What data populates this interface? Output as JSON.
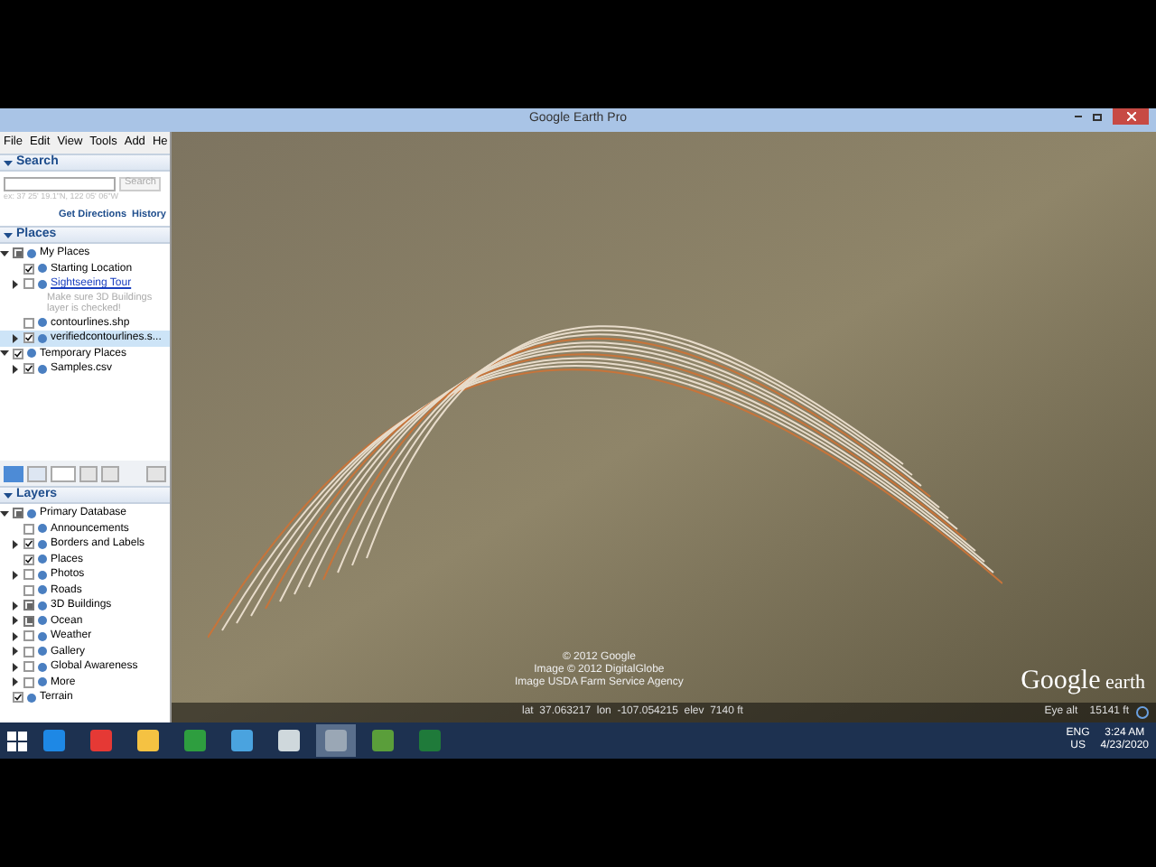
{
  "window": {
    "title": "Google Earth Pro"
  },
  "menu": [
    "File",
    "Edit",
    "View",
    "Tools",
    "Add",
    "He"
  ],
  "search": {
    "title": "Search",
    "placeholder": "ex: 37 25' 19.1\"N, 122 05' 06\"W",
    "button": "Search",
    "links": [
      "Get Directions",
      "History"
    ]
  },
  "places": {
    "title": "Places",
    "items": [
      {
        "label": "My Places",
        "checked": false,
        "partial": true,
        "expanded": true,
        "selected": false,
        "link": false,
        "children": [
          {
            "label": "Starting Location",
            "checked": true,
            "partial": false,
            "selected": false,
            "link": false
          },
          {
            "label": "Sightseeing Tour",
            "link": true,
            "note": "Make sure 3D Buildings layer is checked!",
            "checked": false,
            "partial": false,
            "expanded": false,
            "selected": false
          },
          {
            "label": "contourlines.shp",
            "checked": false,
            "partial": false,
            "selected": false,
            "link": false
          },
          {
            "label": "verifiedcontourlines.s...",
            "checked": true,
            "partial": false,
            "expanded": false,
            "selected": true,
            "link": false
          }
        ]
      },
      {
        "label": "Temporary Places",
        "checked": true,
        "partial": false,
        "expanded": true,
        "selected": false,
        "link": false,
        "children": [
          {
            "label": "Samples.csv",
            "checked": true,
            "partial": false,
            "expanded": false,
            "selected": false,
            "link": false
          }
        ]
      }
    ]
  },
  "layers": {
    "title": "Layers",
    "items": [
      {
        "label": "Primary Database",
        "checked": false,
        "partial": true,
        "expanded": true,
        "selected": false,
        "link": false,
        "children": [
          {
            "label": "Announcements",
            "checked": false,
            "partial": false,
            "selected": false,
            "link": false
          },
          {
            "label": "Borders and Labels",
            "checked": true,
            "partial": false,
            "expanded": false,
            "selected": false,
            "link": false
          },
          {
            "label": "Places",
            "checked": true,
            "partial": false,
            "selected": false,
            "link": false
          },
          {
            "label": "Photos",
            "checked": false,
            "partial": false,
            "expanded": false,
            "selected": false,
            "link": false
          },
          {
            "label": "Roads",
            "checked": false,
            "partial": false,
            "selected": false,
            "link": false
          },
          {
            "label": "3D Buildings",
            "checked": false,
            "partial": true,
            "expanded": false,
            "selected": false,
            "link": false
          },
          {
            "label": "Ocean",
            "checked": false,
            "partial": true,
            "expanded": false,
            "selected": false,
            "link": false
          },
          {
            "label": "Weather",
            "checked": false,
            "partial": false,
            "expanded": false,
            "selected": false,
            "link": false
          },
          {
            "label": "Gallery",
            "checked": false,
            "partial": false,
            "expanded": false,
            "selected": false,
            "link": false
          },
          {
            "label": "Global Awareness",
            "checked": false,
            "partial": false,
            "expanded": false,
            "selected": false,
            "link": false
          },
          {
            "label": "More",
            "checked": false,
            "partial": false,
            "expanded": false,
            "selected": false,
            "link": false
          }
        ]
      },
      {
        "label": "Terrain",
        "checked": true,
        "partial": false,
        "selected": false,
        "link": false
      }
    ]
  },
  "map": {
    "attribution": [
      "© 2012 Google",
      "Image © 2012 DigitalGlobe",
      "Image USDA Farm Service Agency"
    ],
    "logo_word": "Google",
    "logo_suffix": "earth",
    "coordinates": "lat  37.063217  lon  -107.054215  elev  7140 ft",
    "eye_alt": "Eye alt    15141 ft"
  },
  "taskbar": {
    "apps": [
      {
        "kind": "ie",
        "active": false
      },
      {
        "kind": "chrome",
        "active": false
      },
      {
        "kind": "folder",
        "active": false
      },
      {
        "kind": "store",
        "active": false
      },
      {
        "kind": "magnifier",
        "active": false
      },
      {
        "kind": "mic",
        "active": false
      },
      {
        "kind": "earth",
        "active": true
      },
      {
        "kind": "globe",
        "active": false
      },
      {
        "kind": "excel",
        "active": false
      }
    ],
    "language": "ENG",
    "region": "US",
    "time": "3:24 AM",
    "date": "4/23/2020"
  }
}
